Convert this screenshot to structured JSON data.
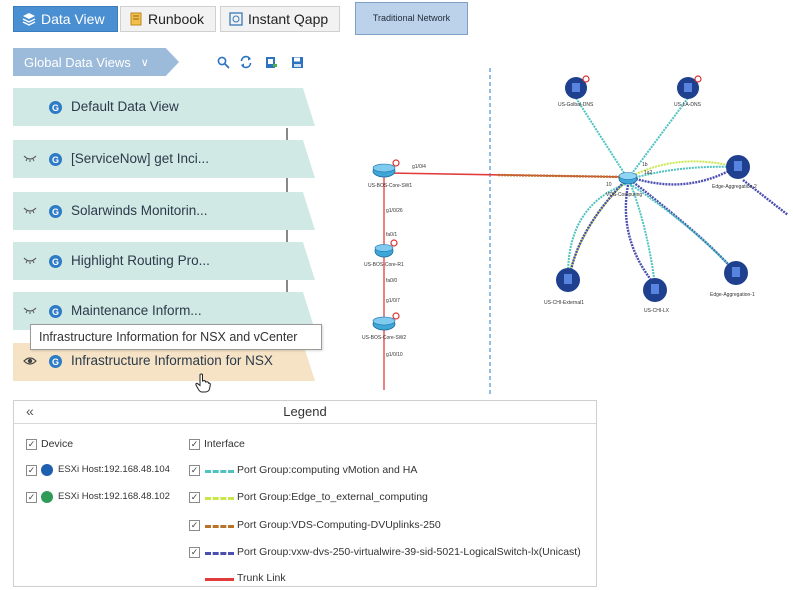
{
  "tabs": [
    {
      "label": "Data View",
      "icon": "layers-icon",
      "active": true
    },
    {
      "label": "Runbook",
      "icon": "runbook-icon",
      "active": false
    },
    {
      "label": "Instant Qapp",
      "icon": "qapp-icon",
      "active": false
    }
  ],
  "map_toolbar": {
    "traditional_network": "Traditional Network"
  },
  "sidebar": {
    "header": "Global Data Views",
    "tool_icons": [
      "search-icon",
      "refresh-icon",
      "export-icon",
      "save-icon"
    ],
    "items": [
      {
        "label": "Default Data View",
        "badge": "G",
        "eye": false,
        "selected": false
      },
      {
        "label": "[ServiceNow] get Inci...",
        "badge": "G",
        "eye": true,
        "selected": false
      },
      {
        "label": "Solarwinds Monitorin...",
        "badge": "G",
        "eye": true,
        "selected": false
      },
      {
        "label": "Highlight Routing Pro...",
        "badge": "G",
        "eye": true,
        "selected": false
      },
      {
        "label": "Maintenance Inform...",
        "badge": "G",
        "eye": true,
        "selected": false
      },
      {
        "label": "Infrastructure Information for NSX",
        "badge": "G",
        "eye": true,
        "selected": true
      }
    ],
    "tooltip": "Infrastructure Information for NSX and vCenter"
  },
  "topology": {
    "nodes": {
      "sw1": "US-BOS-Core-SW1",
      "r1": "US-BOS-Core-R1",
      "sw2": "US-BOS-Core-SW2",
      "gdns": "US-Golbal-DNS",
      "ladns": "US-LA-DNS",
      "vds": "VDS-Computing",
      "agg2": "Edge-Aggregation-2",
      "agg1": "Edge-Aggregation-1",
      "chiext": "US-CHI-External1",
      "chilx": "US-CHI-LX"
    },
    "link_labels": {
      "sw1_right": "g1/0/4",
      "sw1_down": "g1/0/26",
      "r1_up": "fa0/1",
      "r1_down": "fa0/0",
      "sw2_up": "g1/0/7",
      "sw2_down": "g1/0/10",
      "vds_left": "10",
      "vds_right": "1b",
      "vds_right2": "1a2"
    }
  },
  "legend": {
    "title": "Legend",
    "device_header": "Device",
    "interface_header": "Interface",
    "devices": [
      {
        "label": "ESXi Host:192.168.48.104",
        "color": "#1f5fb0"
      },
      {
        "label": "ESXi Host:192.168.48.102",
        "color": "#2f9b58"
      }
    ],
    "interfaces": [
      {
        "label": "Port Group:computing vMotion and HA",
        "color": "#4fc3c0"
      },
      {
        "label": "Port Group:Edge_to_external_computing",
        "color": "#c8e84a"
      },
      {
        "label": "Port Group:VDS-Computing-DVUplinks-250",
        "color": "#b8732a"
      },
      {
        "label": "Port Group:vxw-dvs-250-virtualwire-39-sid-5021-LogicalSwitch-lx(Unicast)",
        "color": "#4b4fb0"
      },
      {
        "label": "Trunk Link",
        "color": "#e33b3b"
      }
    ]
  },
  "colors": {
    "tab_active": "#4a8fd1",
    "sidebar_header": "#9cbad9",
    "item_bg": "#d1e9e5",
    "item_selected": "#f6e3c6",
    "vm_node": "#1f3f8f"
  }
}
